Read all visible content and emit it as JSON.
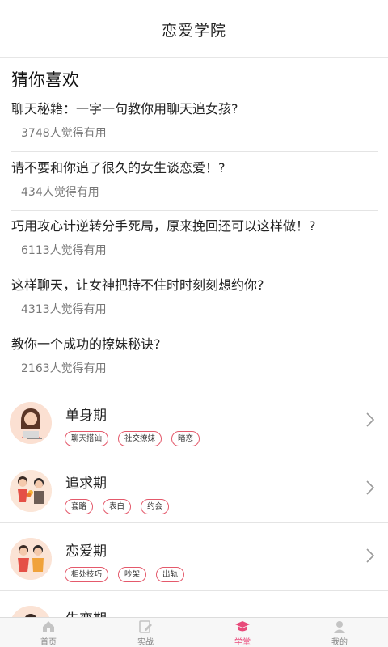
{
  "header": {
    "title": "恋爱学院"
  },
  "recommend": {
    "title": "猜你喜欢",
    "articles": [
      {
        "title": "聊天秘籍：一字一句教你用聊天追女孩?",
        "meta": "3748人觉得有用"
      },
      {
        "title": "请不要和你追了很久的女生谈恋爱！?",
        "meta": "434人觉得有用"
      },
      {
        "title": "巧用攻心计逆转分手死局，原来挽回还可以这样做！?",
        "meta": "6113人觉得有用"
      },
      {
        "title": "这样聊天，让女神把持不住时时刻刻想约你?",
        "meta": "4313人觉得有用"
      },
      {
        "title": "教你一个成功的撩妹秘诀?",
        "meta": "2163人觉得有用"
      }
    ]
  },
  "stages": [
    {
      "title": "单身期",
      "tags": [
        "聊天搭讪",
        "社交撩妹",
        "暗恋"
      ],
      "avatar_icon": "single-person-laptop-icon"
    },
    {
      "title": "追求期",
      "tags": [
        "套路",
        "表白",
        "约会"
      ],
      "avatar_icon": "pursuit-flowers-icon"
    },
    {
      "title": "恋爱期",
      "tags": [
        "相处技巧",
        "吵架",
        "出轨"
      ],
      "avatar_icon": "couple-icon"
    },
    {
      "title": "失恋期",
      "tags": [],
      "avatar_icon": "breakup-icon"
    }
  ],
  "tabbar": {
    "tabs": [
      {
        "label": "首页",
        "icon": "home-icon",
        "active": false
      },
      {
        "label": "实战",
        "icon": "edit-icon",
        "active": false
      },
      {
        "label": "学堂",
        "icon": "graduation-cap-icon",
        "active": true
      },
      {
        "label": "我的",
        "icon": "user-icon",
        "active": false
      }
    ]
  },
  "colors": {
    "accent": "#e84a7a",
    "tag_border": "#e4596b"
  }
}
